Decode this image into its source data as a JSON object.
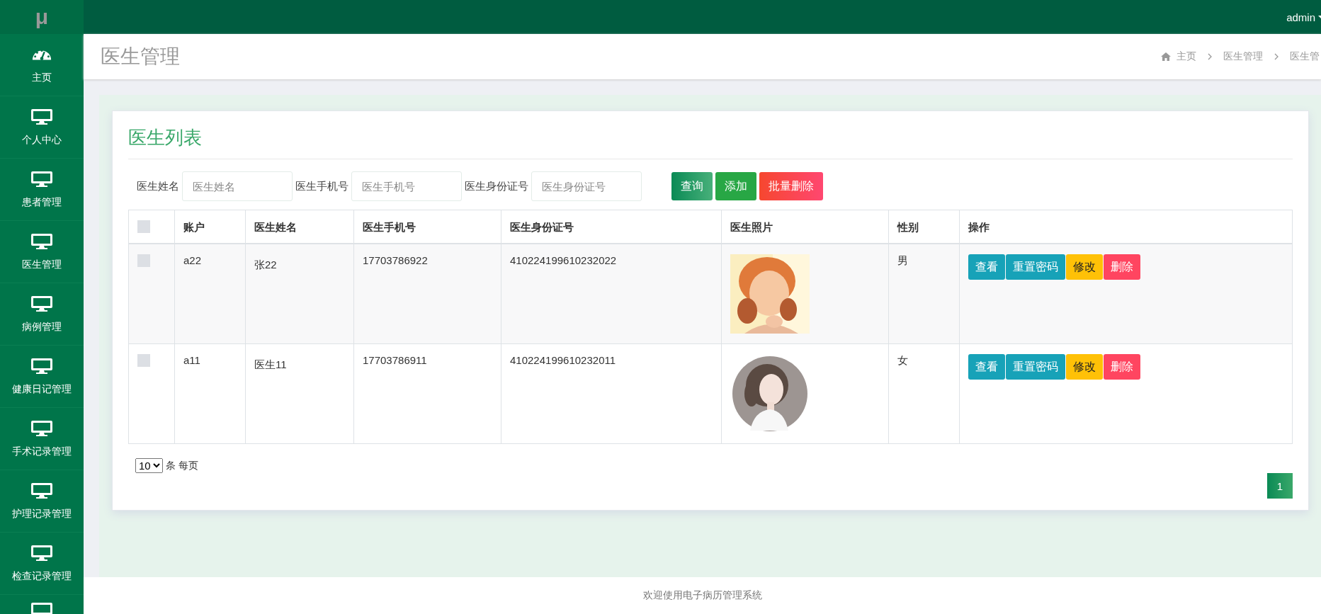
{
  "logo": "μ",
  "user_menu": {
    "label": "admin"
  },
  "sidebar": {
    "items": [
      {
        "label": "主页"
      },
      {
        "label": "个人中心"
      },
      {
        "label": "患者管理"
      },
      {
        "label": "医生管理"
      },
      {
        "label": "病例管理"
      },
      {
        "label": "健康日记管理"
      },
      {
        "label": "手术记录管理"
      },
      {
        "label": "护理记录管理"
      },
      {
        "label": "检查记录管理"
      }
    ]
  },
  "page_title": "医生管理",
  "breadcrumb": [
    "主页",
    "医生管理",
    "医生管"
  ],
  "card_title": "医生列表",
  "filters": [
    {
      "label": "医生姓名",
      "placeholder": "医生姓名"
    },
    {
      "label": "医生手机号",
      "placeholder": "医生手机号"
    },
    {
      "label": "医生身份证号",
      "placeholder": "医生身份证号"
    }
  ],
  "actions": [
    {
      "label": "查询",
      "kind": "search"
    },
    {
      "label": "添加",
      "kind": "add"
    },
    {
      "label": "批量删除",
      "kind": "delete"
    }
  ],
  "table": {
    "select_all": {
      "checked": false
    },
    "columns": [
      "账户",
      "医生姓名",
      "医生手机号",
      "医生身份证号",
      "医生照片",
      "性别",
      "操作"
    ],
    "rows": [
      {
        "checked": false,
        "account": "a22",
        "name": "张22",
        "phone": "17703786922",
        "id_number": "410224199610232022",
        "gender": "男",
        "buttons": [
          {
            "label": "查看",
            "kind": "view"
          },
          {
            "label": "重置密码",
            "kind": "reset"
          },
          {
            "label": "修改",
            "kind": "edit"
          },
          {
            "label": "删除",
            "kind": "delete"
          }
        ]
      },
      {
        "checked": false,
        "account": "a11",
        "name": "医生11",
        "phone": "17703786911",
        "id_number": "410224199610232011",
        "gender": "女",
        "buttons": [
          {
            "label": "查看",
            "kind": "view"
          },
          {
            "label": "重置密码",
            "kind": "reset"
          },
          {
            "label": "修改",
            "kind": "edit"
          },
          {
            "label": "删除",
            "kind": "delete"
          }
        ]
      }
    ]
  },
  "page_size": {
    "value": "10",
    "suffix": "条 每页"
  },
  "pagination": [
    {
      "label": "1",
      "selected": true
    }
  ],
  "footer": "欢迎使用电子病历管理系统"
}
